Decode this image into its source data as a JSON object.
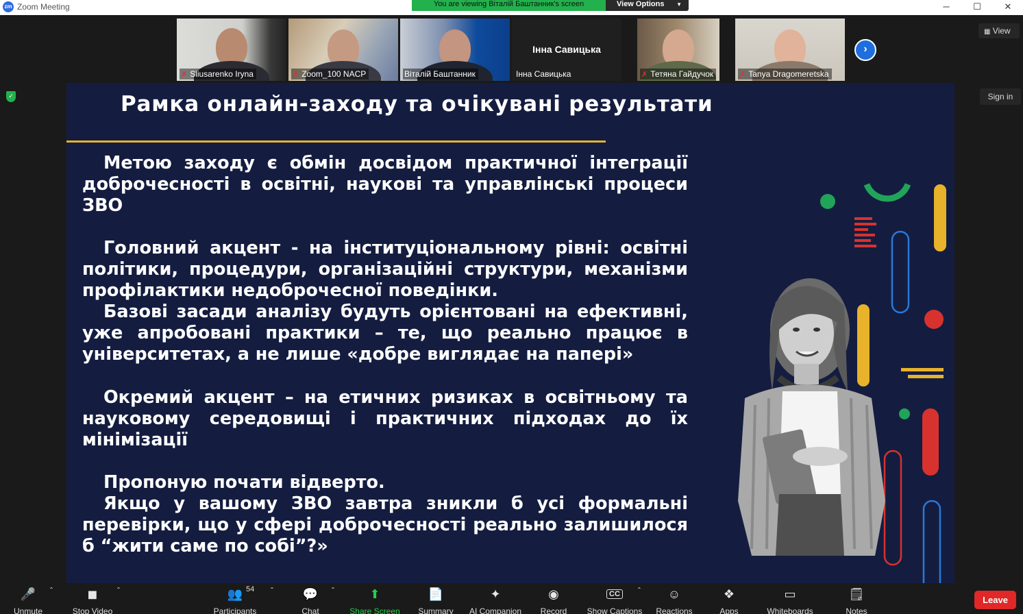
{
  "window": {
    "title": "Zoom Meeting",
    "logo_text": "zm",
    "viewing_banner": "You are viewing Віталій Баштанник's screen",
    "view_options": "View Options",
    "controls": {
      "minimize": "─",
      "maximize": "☐",
      "close": "✕"
    }
  },
  "participants": [
    {
      "name": "Sliusarenko Iryna",
      "muted": true
    },
    {
      "name": "Zoom_100 NACP",
      "muted": true
    },
    {
      "name": "Віталій Баштанник",
      "muted": false,
      "active": true
    },
    {
      "name": "Інна Савицька",
      "muted": false,
      "display_name": "Інна Савицька"
    },
    {
      "name": "Тетяна Гайдучок",
      "muted": true
    },
    {
      "name": "Tanya Dragomeretska",
      "muted": true
    }
  ],
  "top_right": {
    "view_label": "View",
    "sign_in_label": "Sign in"
  },
  "slide": {
    "title": "Рамка онлайн-заходу та очікувані результати",
    "paragraphs": [
      "Метою заходу є обмін досвідом практичної інтеграції доброчесності в освітні, наукові та управлінські процеси ЗВО",
      "Головний акцент - на інституціональному рівні: освітні політики, процедури, організаційні структури, механізми профілактики недоброчесної поведінки.",
      "Базові засади аналізу будуть орієнтовані на ефективні, уже апробовані практики – те, що реально працює в університетах, а не лише «добре виглядає на папері»",
      "Окремий акцент – на етичних ризиках в освітньому та науковому середовищі і практичних підходах до їх мінімізації",
      "Пропоную почати відверто.",
      "Якщо у вашому ЗВО завтра зникли б усі формальні перевірки, що у сфері доброчесності реально залишилося б “жити саме по собі”?»"
    ],
    "colors": {
      "background": "#141d40",
      "accent": "#e8b22b"
    }
  },
  "toolbar": {
    "unmute": "Unmute",
    "stop_video": "Stop Video",
    "participants": "Participants",
    "participants_count": "54",
    "chat": "Chat",
    "share_screen": "Share Screen",
    "summary": "Summary",
    "ai_companion": "AI Companion",
    "record": "Record",
    "show_captions": "Show Captions",
    "captions_icon": "CC",
    "reactions": "Reactions",
    "apps": "Apps",
    "whiteboards": "Whiteboards",
    "notes": "Notes",
    "leave": "Leave"
  }
}
